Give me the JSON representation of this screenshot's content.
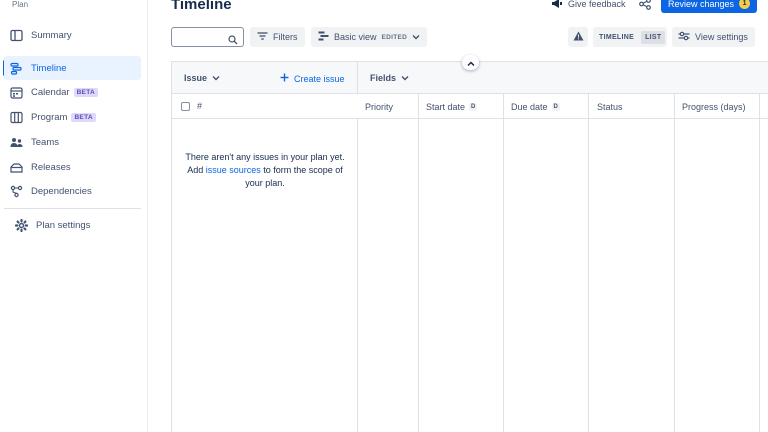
{
  "sidebar": {
    "plan_label": "Plan",
    "items": [
      {
        "label": "Summary",
        "icon": "summary-icon"
      },
      {
        "label": "Timeline",
        "icon": "timeline-icon",
        "active": true
      },
      {
        "label": "Calendar",
        "icon": "calendar-icon",
        "badge": "BETA"
      },
      {
        "label": "Program",
        "icon": "program-icon",
        "badge": "BETA"
      },
      {
        "label": "Teams",
        "icon": "teams-icon"
      },
      {
        "label": "Releases",
        "icon": "releases-icon"
      },
      {
        "label": "Dependencies",
        "icon": "dependencies-icon"
      }
    ],
    "settings_label": "Plan settings"
  },
  "header": {
    "title": "Timeline",
    "feedback_label": "Give feedback",
    "review_label": "Review changes",
    "review_count": "1"
  },
  "toolbar": {
    "search_value": "",
    "filters_label": "Filters",
    "view_label": "Basic view",
    "view_status": "EDITED",
    "seg_timeline": "TIMELINE",
    "seg_list": "LIST",
    "view_settings_label": "View settings"
  },
  "table": {
    "issue_header": "Issue",
    "create_issue_label": "Create issue",
    "fields_header": "Fields",
    "hash_label": "#",
    "columns": [
      {
        "label": "Priority"
      },
      {
        "label": "Start date",
        "badge": "D"
      },
      {
        "label": "Due date",
        "badge": "D"
      },
      {
        "label": "Status"
      },
      {
        "label": "Progress (days)"
      }
    ],
    "empty_line1": "There aren't any issues in your plan yet.",
    "empty_add": "Add",
    "empty_link": "issue sources",
    "empty_line2": "to form the scope of your plan."
  },
  "colors": {
    "accent": "#0c66e4",
    "active_bg": "#e9f2ff",
    "badge_bg": "#dfd8fd",
    "review_count_bg": "#f5cd47"
  }
}
